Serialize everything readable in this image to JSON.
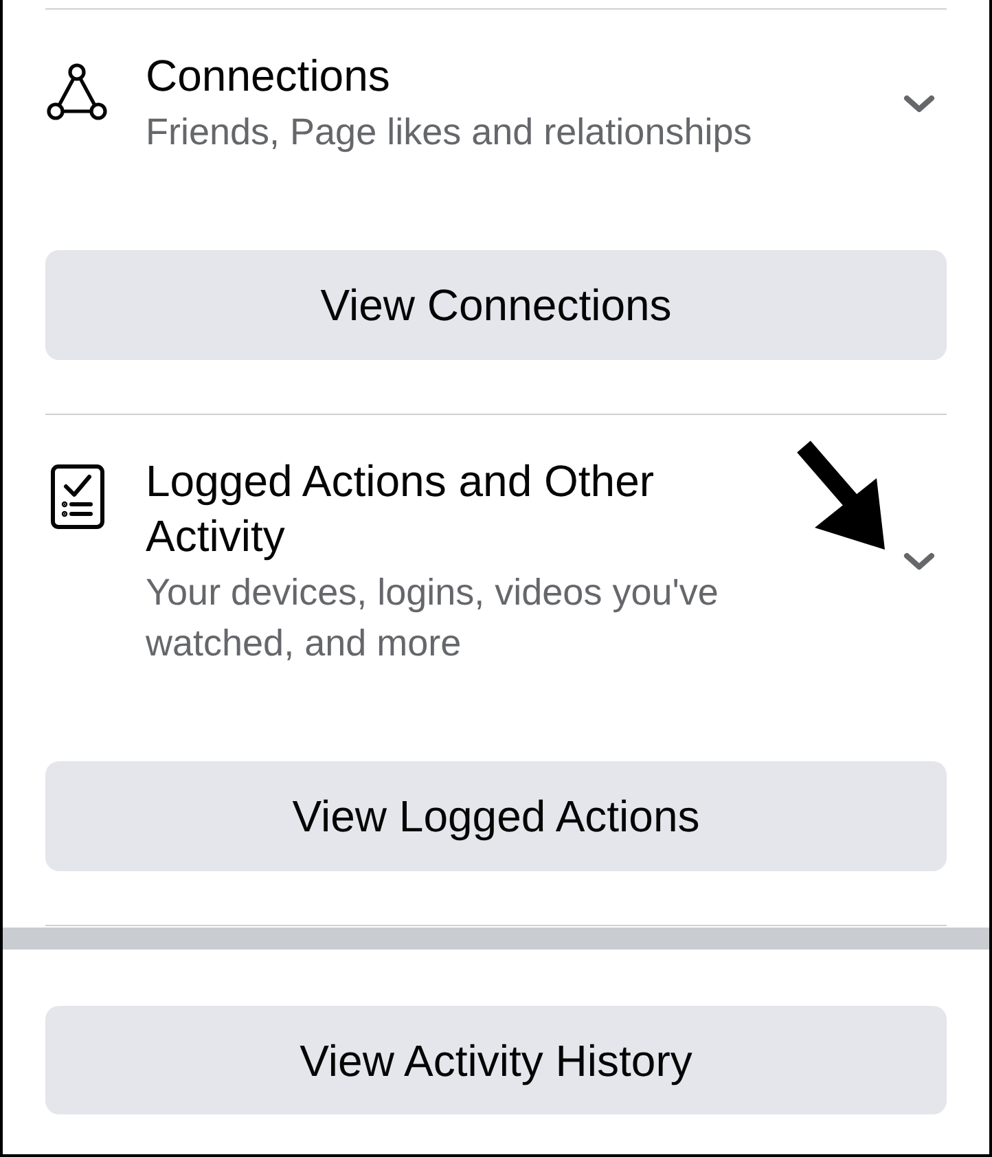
{
  "sections": [
    {
      "title": "Connections",
      "subtitle": "Friends, Page likes and relationships",
      "expanded": false,
      "button": "View Connections"
    },
    {
      "title": "Logged Actions and Other Activity",
      "subtitle": "Your devices, logins, videos you've watched, and more",
      "expanded": false,
      "button": "View Logged Actions"
    }
  ],
  "footer_button": "View Activity History"
}
